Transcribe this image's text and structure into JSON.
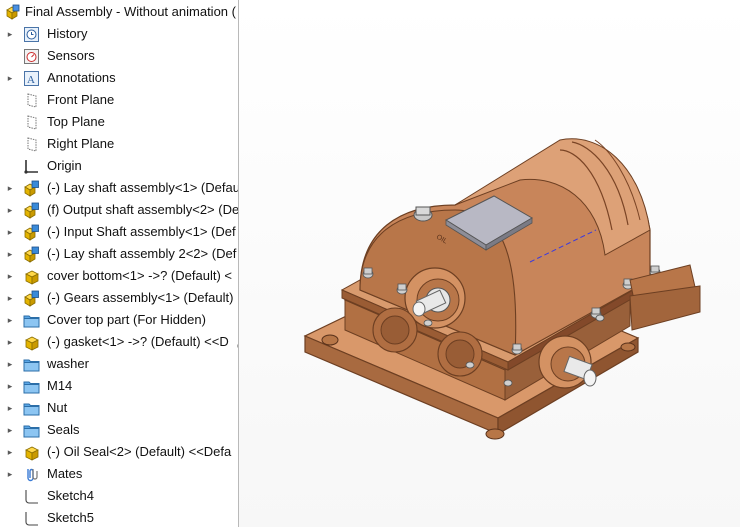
{
  "tree": {
    "root": {
      "label": "Final Assembly - Without animation ("
    },
    "items": [
      {
        "label": "History",
        "icon": "history-icon",
        "expandable": true
      },
      {
        "label": "Sensors",
        "icon": "sensors-icon",
        "expandable": false
      },
      {
        "label": "Annotations",
        "icon": "annotations-icon",
        "expandable": true
      },
      {
        "label": "Front Plane",
        "icon": "plane-icon",
        "expandable": false
      },
      {
        "label": "Top Plane",
        "icon": "plane-icon",
        "expandable": false
      },
      {
        "label": "Right Plane",
        "icon": "plane-icon",
        "expandable": false
      },
      {
        "label": "Origin",
        "icon": "origin-icon",
        "expandable": false
      },
      {
        "label": "(-) Lay shaft assembly<1> (Defau",
        "icon": "subassembly-icon",
        "expandable": true
      },
      {
        "label": "(f) Output shaft assembly<2> (De",
        "icon": "subassembly-icon",
        "expandable": true
      },
      {
        "label": "(-) Input Shaft assembly<1> (Def",
        "icon": "subassembly-icon",
        "expandable": true
      },
      {
        "label": "(-) Lay shaft assembly 2<2> (Def",
        "icon": "subassembly-icon",
        "expandable": true
      },
      {
        "label": "cover bottom<1> ->? (Default) <",
        "icon": "part-icon",
        "expandable": true
      },
      {
        "label": "(-) Gears assembly<1> (Default)",
        "icon": "subassembly-icon",
        "expandable": true
      },
      {
        "label": "Cover top part (For Hidden)",
        "icon": "folder-icon",
        "expandable": true
      },
      {
        "label": "(-) gasket<1> ->? (Default) <<D",
        "icon": "part-icon",
        "expandable": true
      },
      {
        "label": "washer",
        "icon": "folder-icon",
        "expandable": true
      },
      {
        "label": "M14",
        "icon": "folder-icon",
        "expandable": true
      },
      {
        "label": "Nut",
        "icon": "folder-icon",
        "expandable": true
      },
      {
        "label": "Seals",
        "icon": "folder-icon",
        "expandable": true
      },
      {
        "label": "(-) Oil Seal<2> (Default) <<Defa",
        "icon": "part-icon",
        "expandable": true
      },
      {
        "label": "Mates",
        "icon": "mates-icon",
        "expandable": true
      },
      {
        "label": "Sketch4",
        "icon": "sketch-icon",
        "expandable": false
      },
      {
        "label": "Sketch5",
        "icon": "sketch-icon",
        "expandable": false
      }
    ]
  },
  "model": {
    "oil_mark": "OIL"
  },
  "colors": {
    "casing": "#c8855a",
    "casing_dark": "#8a5232",
    "casing_light": "#e2a97f",
    "plate": "#b8b8c4",
    "shaft": "#d8d8d8"
  }
}
